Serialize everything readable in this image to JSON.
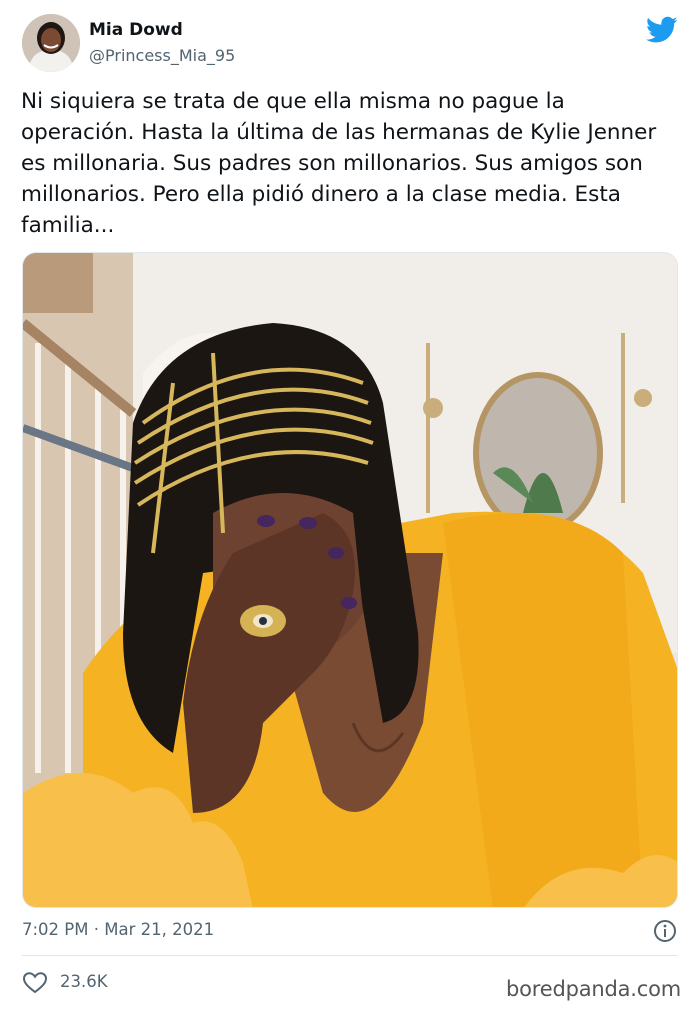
{
  "author": {
    "display_name": "Mia Dowd",
    "handle": "@Princess_Mia_95"
  },
  "tweet": {
    "text": "Ni siquiera se trata de que ella misma no pague la operación. Hasta la última de las hermanas de Kylie Jenner es millonaria. Sus padres son millonarios. Sus amigos son millonarios. Pero ella pidió dinero a la clase media. Esta familia...",
    "timestamp": "7:02 PM · Mar 21, 2021",
    "likes": "23.6K"
  },
  "icons": {
    "brand": "twitter-bird-icon",
    "info": "info-icon",
    "like": "heart-icon"
  },
  "colors": {
    "twitter_blue": "#1d9bf0",
    "secondary_text": "#536471",
    "divider": "#e1e8ed"
  },
  "watermark": "boredpanda.com"
}
